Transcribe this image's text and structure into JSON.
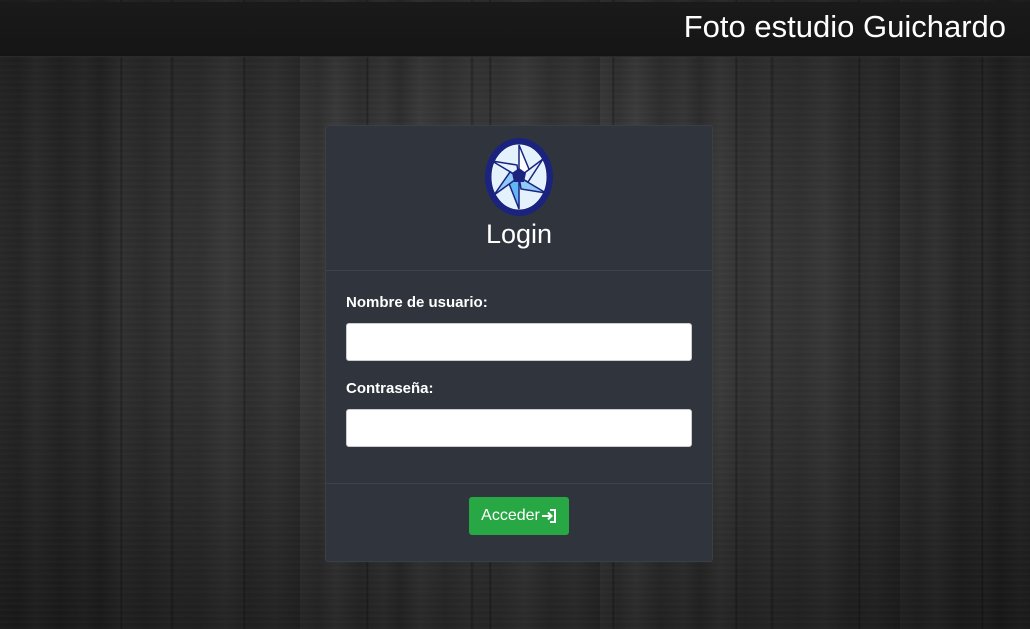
{
  "header": {
    "brand": "Foto estudio Guichardo"
  },
  "login": {
    "title": "Login",
    "logo_icon": "camera-aperture-icon",
    "username_label": "Nombre de usuario:",
    "username_value": "",
    "password_label": "Contraseña:",
    "password_value": "",
    "submit_label": "Acceder",
    "submit_icon": "sign-in-icon"
  },
  "colors": {
    "topbar": "#151515",
    "card": "#30353d",
    "button": "#28a745",
    "logo_ring": "#1a237e",
    "logo_blade_light": "#e3f2fd",
    "logo_blade_mid": "#90caf9",
    "logo_blade_dark": "#64b5f6"
  }
}
